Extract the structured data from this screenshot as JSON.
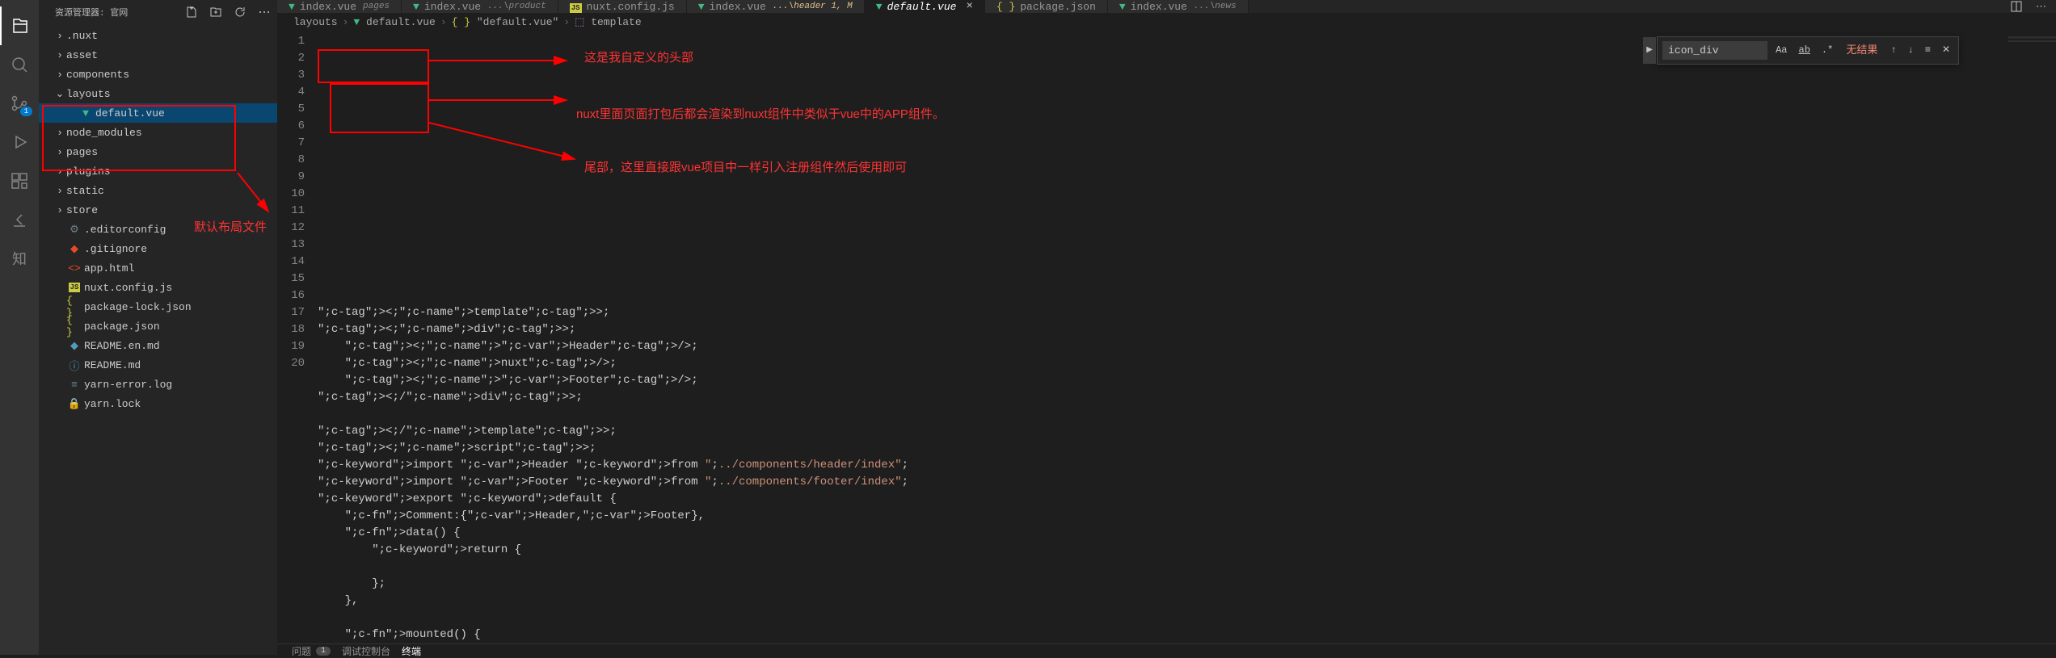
{
  "sidebar": {
    "title": "资源管理器: 官网",
    "items": [
      {
        "label": ".nuxt",
        "type": "folder",
        "expanded": false,
        "indent": 1
      },
      {
        "label": "asset",
        "type": "folder",
        "expanded": false,
        "indent": 1
      },
      {
        "label": "components",
        "type": "folder",
        "expanded": false,
        "indent": 1
      },
      {
        "label": "layouts",
        "type": "folder",
        "expanded": true,
        "indent": 1,
        "boxed": true
      },
      {
        "label": "default.vue",
        "type": "file",
        "icon": "vue",
        "indent": 2,
        "selected": true
      },
      {
        "label": "node_modules",
        "type": "folder",
        "expanded": false,
        "indent": 1
      },
      {
        "label": "pages",
        "type": "folder",
        "expanded": false,
        "indent": 1
      },
      {
        "label": "plugins",
        "type": "folder",
        "expanded": false,
        "indent": 1
      },
      {
        "label": "static",
        "type": "folder",
        "expanded": false,
        "indent": 1
      },
      {
        "label": "store",
        "type": "folder",
        "expanded": false,
        "indent": 1
      },
      {
        "label": ".editorconfig",
        "type": "file",
        "icon": "config",
        "indent": 1
      },
      {
        "label": ".gitignore",
        "type": "file",
        "icon": "git",
        "indent": 1
      },
      {
        "label": "app.html",
        "type": "file",
        "icon": "html",
        "indent": 1
      },
      {
        "label": "nuxt.config.js",
        "type": "file",
        "icon": "js",
        "indent": 1
      },
      {
        "label": "package-lock.json",
        "type": "file",
        "icon": "json",
        "indent": 1
      },
      {
        "label": "package.json",
        "type": "file",
        "icon": "json",
        "indent": 1
      },
      {
        "label": "README.en.md",
        "type": "file",
        "icon": "md",
        "indent": 1
      },
      {
        "label": "README.md",
        "type": "file",
        "icon": "info",
        "indent": 1
      },
      {
        "label": "yarn-error.log",
        "type": "file",
        "icon": "log",
        "indent": 1
      },
      {
        "label": "yarn.lock",
        "type": "file",
        "icon": "lock",
        "indent": 1
      }
    ]
  },
  "tabs": [
    {
      "icon": "vue",
      "label": "index.vue",
      "sub": "pages"
    },
    {
      "icon": "vue",
      "label": "index.vue",
      "sub": "...\\product"
    },
    {
      "icon": "js",
      "label": "nuxt.config.js",
      "sub": ""
    },
    {
      "icon": "vue",
      "label": "index.vue",
      "sub": "...\\header 1, M",
      "modified": true
    },
    {
      "icon": "vue",
      "label": "default.vue",
      "sub": "",
      "active": true,
      "italic": true
    },
    {
      "icon": "json",
      "label": "package.json",
      "sub": ""
    },
    {
      "icon": "vue",
      "label": "index.vue",
      "sub": "...\\news"
    }
  ],
  "breadcrumb": [
    "layouts",
    "default.vue",
    "\"default.vue\"",
    "template"
  ],
  "breadcrumb_icons": [
    "",
    "vue",
    "json",
    "template"
  ],
  "find": {
    "value": "icon_div",
    "result": "无结果"
  },
  "code_lines": [
    "<template>",
    "<div>",
    "    <Header/>",
    "    <nuxt/>",
    "    <Footer/>",
    "</div>",
    "",
    "</template>",
    "<script>",
    "import Header from \"../components/header/index\"",
    "import Footer from \"../components/footer/index\"",
    "export default {",
    "    Comment:{Header,Footer},",
    "    data() {",
    "        return {",
    "",
    "        };",
    "    },",
    "",
    "    mounted() {"
  ],
  "line_start": 1,
  "annotations": {
    "layout_label": "默认布局文件",
    "header_note": "这是我自定义的头部",
    "nuxt_note": "nuxt里面页面打包后都会渲染到nuxt组件中类似于vue中的APP组件。",
    "footer_note": "尾部，这里直接跟vue项目中一样引入注册组件然后使用即可"
  },
  "bottom": {
    "problems": "问题",
    "problems_count": "1",
    "debug": "调试控制台",
    "terminal": "终端"
  },
  "scm_badge": "1"
}
